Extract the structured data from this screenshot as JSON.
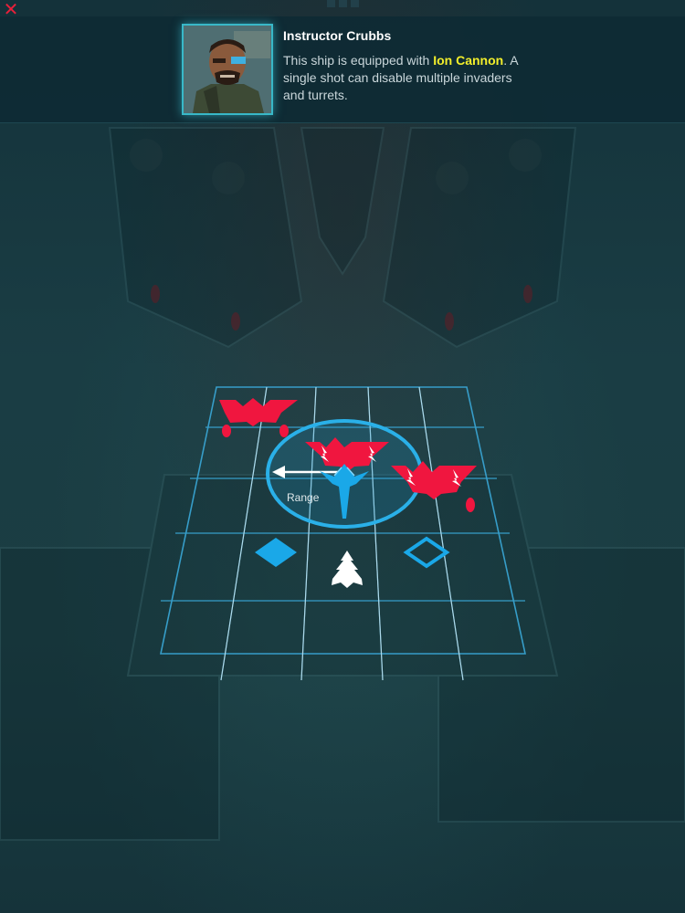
{
  "dialog": {
    "speaker": "Instructor Crubbs",
    "message_parts": {
      "before": "This ship is equipped with ",
      "highlight": "Ion Cannon",
      "after": ". A single shot can disable multiple invaders and turrets."
    },
    "portrait_icon": "instructor-portrait"
  },
  "close_icon": "close-x-icon",
  "board": {
    "range_label": "Range",
    "colors": {
      "enemy": "#f0163f",
      "player": "#1aa8e8",
      "grid": "#3aa8d8",
      "ally": "#ffffff",
      "range_ring": "#2ab0e8"
    },
    "invaders": [
      {
        "name": "invader-top-left",
        "disabled": false
      },
      {
        "name": "invader-center",
        "disabled": true
      },
      {
        "name": "invader-right",
        "disabled": true
      }
    ],
    "turrets": [
      {
        "name": "turret-filled",
        "state": "active"
      },
      {
        "name": "turret-outline",
        "state": "target"
      }
    ]
  }
}
